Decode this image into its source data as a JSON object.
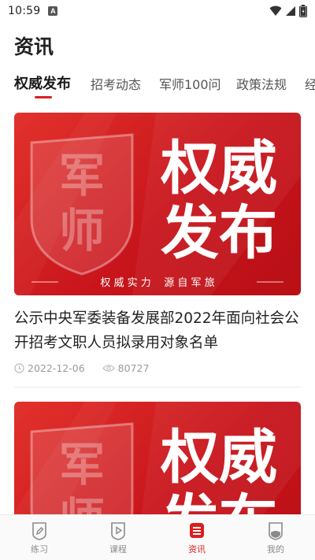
{
  "status_bar": {
    "time": "10:59",
    "notification_icon": "A"
  },
  "page": {
    "title": "资讯"
  },
  "tabs": [
    {
      "label": "权威发布",
      "active": true
    },
    {
      "label": "招考动态",
      "active": false
    },
    {
      "label": "军师100问",
      "active": false
    },
    {
      "label": "政策法规",
      "active": false
    },
    {
      "label": "经",
      "active": false
    }
  ],
  "banner": {
    "big_text_line1": "权威",
    "big_text_line2": "发布",
    "shield_text_top": "军",
    "shield_text_bottom": "师",
    "slogan": "权 威 实 力    源 自 军 旅"
  },
  "articles": [
    {
      "title": "公示中央军委装备发展部2022年面向社会公开招考文职人员拟录用对象名单",
      "date": "2022-12-06",
      "views": "80727"
    }
  ],
  "bottom_nav": [
    {
      "label": "练习",
      "icon": "pencil-icon",
      "active": false
    },
    {
      "label": "课程",
      "icon": "play-icon",
      "active": false
    },
    {
      "label": "资讯",
      "icon": "news-icon",
      "active": true
    },
    {
      "label": "我的",
      "icon": "profile-icon",
      "active": false
    }
  ],
  "colors": {
    "accent": "#d9201f",
    "banner_red": "#c8141b"
  }
}
